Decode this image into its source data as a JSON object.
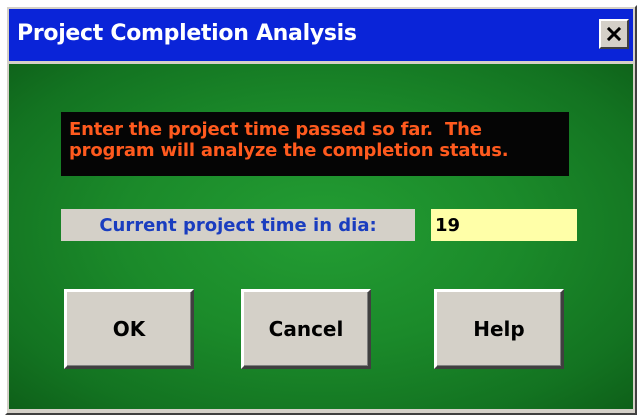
{
  "window": {
    "title": "Project Completion Analysis",
    "close_icon": "close-icon"
  },
  "dialog": {
    "message_line1": "Enter the project time passed so far.  The",
    "message_line2": "program will analyze the completion status.",
    "field_label": "Current project time in dia:",
    "field_value": "19"
  },
  "buttons": {
    "ok_label": "OK",
    "cancel_label": "Cancel",
    "help_label": "Help"
  },
  "colors": {
    "titlebar": "#0a24d8",
    "background_green": "#1b8a2a",
    "message_text": "#ff5a1e",
    "label_text": "#1a3dbf",
    "input_background": "#ffffa8"
  }
}
